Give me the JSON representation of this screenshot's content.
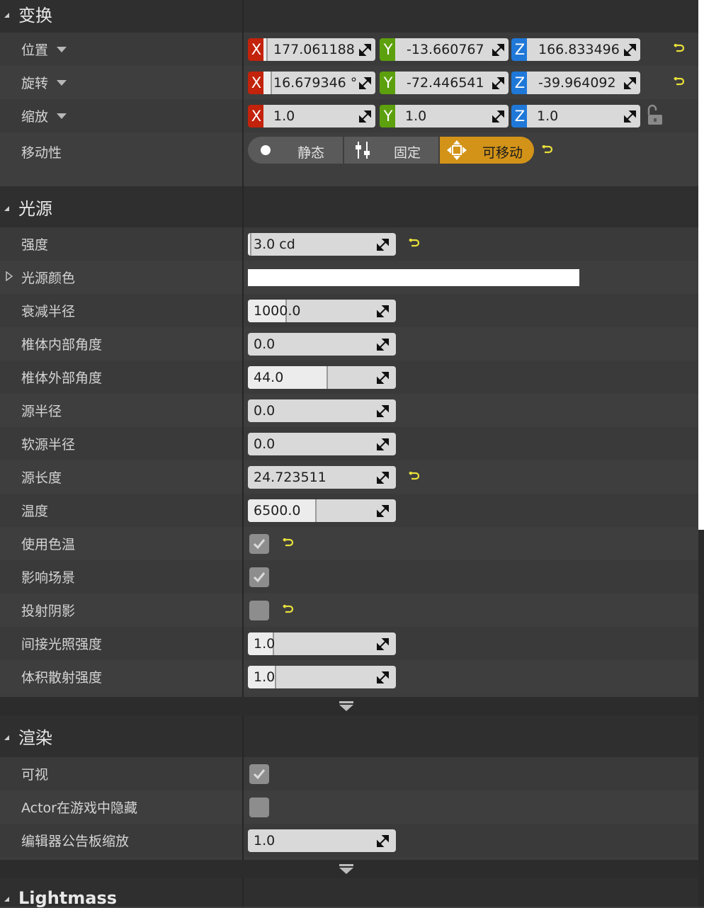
{
  "transform": {
    "title": "变换",
    "location": {
      "label": "位置",
      "x": "177.061188",
      "y": "-13.660767",
      "z": "166.833496"
    },
    "rotation": {
      "label": "旋转",
      "x": "16.679346 °",
      "y": "-72.446541",
      "z": "-39.964092"
    },
    "scale": {
      "label": "缩放",
      "x": "1.0",
      "y": "1.0",
      "z": "1.0"
    },
    "mobility": {
      "label": "移动性",
      "static": "静态",
      "stationary": "固定",
      "movable": "可移动",
      "selected": "可移动"
    },
    "axis_x": "X",
    "axis_y": "Y",
    "axis_z": "Z"
  },
  "light": {
    "title": "光源",
    "intensity": {
      "label": "强度",
      "value": "3.0 cd"
    },
    "light_color": {
      "label": "光源颜色",
      "color": "#ffffff"
    },
    "attenuation_radius": {
      "label": "衰减半径",
      "value": "1000.0"
    },
    "inner_cone_angle": {
      "label": "椎体内部角度",
      "value": "0.0"
    },
    "outer_cone_angle": {
      "label": "椎体外部角度",
      "value": "44.0"
    },
    "source_radius": {
      "label": "源半径",
      "value": "0.0"
    },
    "soft_source_radius": {
      "label": "软源半径",
      "value": "0.0"
    },
    "source_length": {
      "label": "源长度",
      "value": "24.723511"
    },
    "temperature": {
      "label": "温度",
      "value": "6500.0"
    },
    "use_temperature": {
      "label": "使用色温",
      "checked": true
    },
    "affects_world": {
      "label": "影响场景",
      "checked": true
    },
    "cast_shadows": {
      "label": "投射阴影",
      "checked": false
    },
    "indirect_intensity": {
      "label": "间接光照强度",
      "value": "1.0"
    },
    "volumetric_scattering": {
      "label": "体积散射强度",
      "value": "1.0"
    }
  },
  "rendering": {
    "title": "渲染",
    "visible": {
      "label": "可视",
      "checked": true
    },
    "hidden_in_game": {
      "label": "Actor在游戏中隐藏",
      "checked": false
    },
    "billboard_scale": {
      "label": "编辑器公告板缩放",
      "value": "1.0"
    }
  },
  "lightmass": {
    "title": "Lightmass"
  },
  "colors": {
    "reset_arrow": "#e8e03a",
    "mobility_selected": "#d39319"
  }
}
